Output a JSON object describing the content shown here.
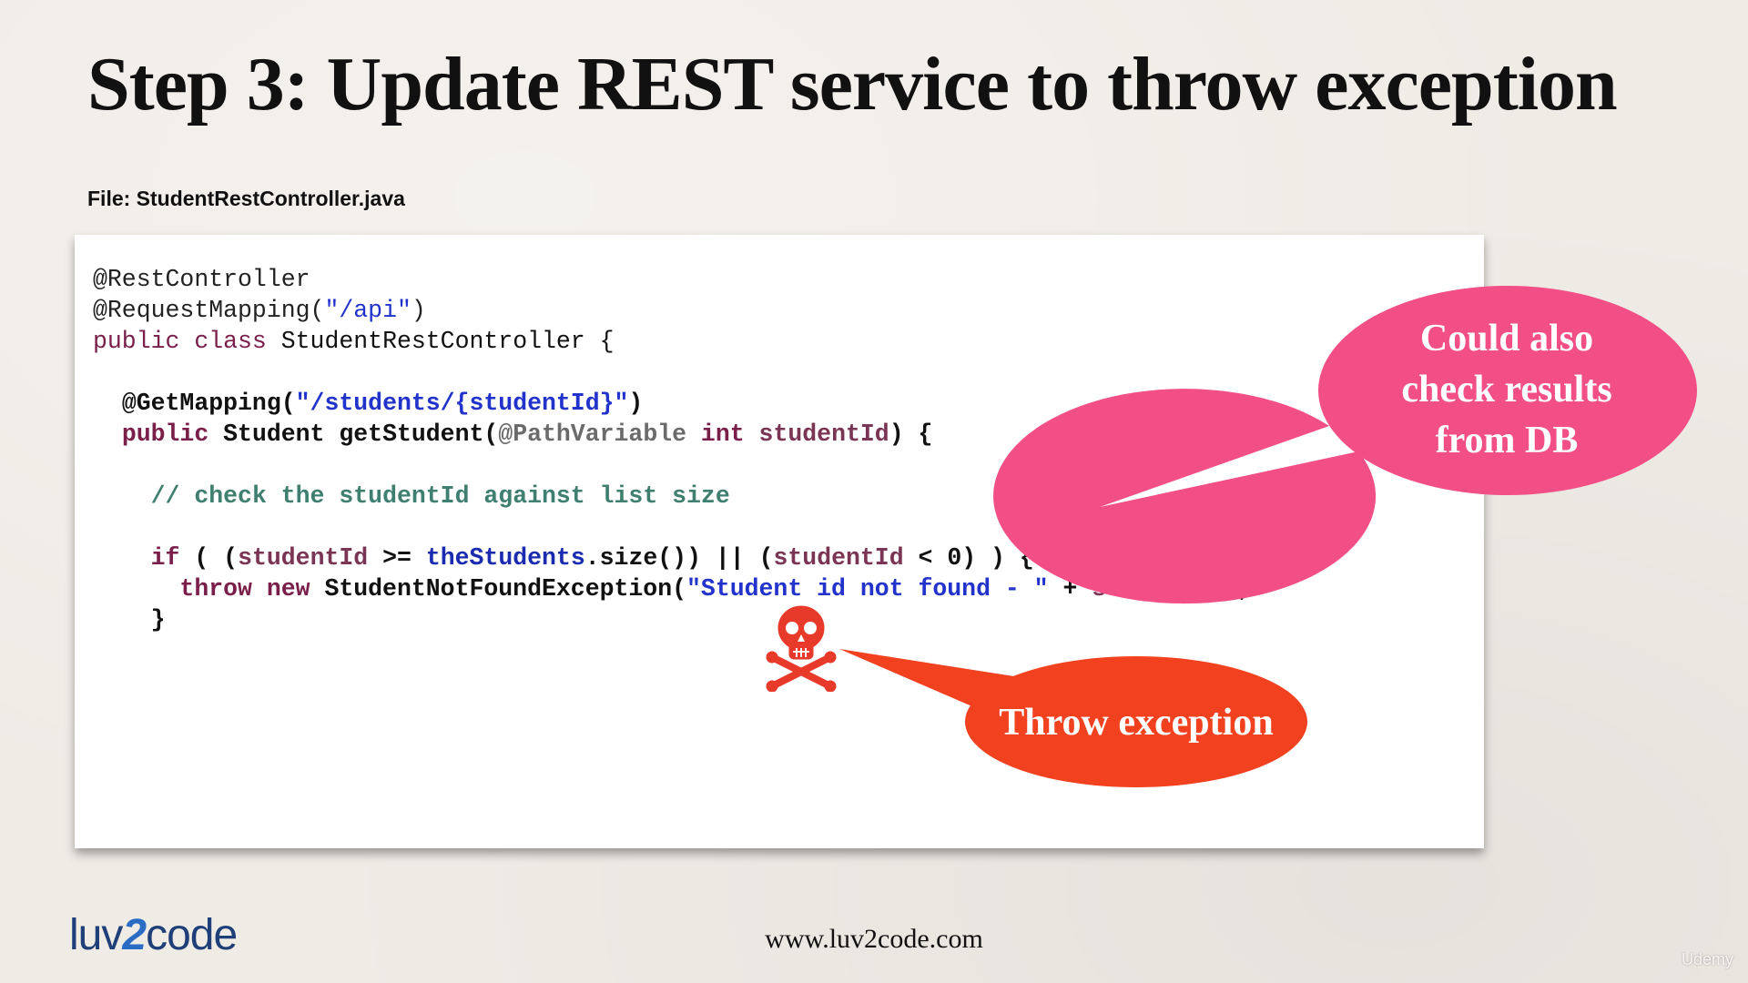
{
  "slide": {
    "title": "Step 3:  Update REST service to throw exception",
    "file_label": "File: StudentRestController.java"
  },
  "code": {
    "line1_annotation": "@RestController",
    "line2_annotation": "@RequestMapping(",
    "line2_string": "\"/api\"",
    "line2_close": ")",
    "line3_kw": "public class",
    "line3_name": " StudentRestController {",
    "line5_annotation": "@GetMapping(",
    "line5_string": "\"/students/{studentId}\"",
    "line5_close": ")",
    "line6_kw": "public",
    "line6_mid": " Student getStudent(",
    "line6_ann": "@PathVariable",
    "line6_type": " int",
    "line6_var": " studentId",
    "line6_close": ") {",
    "line8_comment": "// check the studentId against list size",
    "line10_kw": "if",
    "line10_a": " ( (",
    "line10_var1": "studentId",
    "line10_b": " >= ",
    "line10_field": "theStudents",
    "line10_c": ".size()) || (",
    "line10_var2": "studentId",
    "line10_d": " < 0) ) {",
    "line11_kw": "throw new",
    "line11_a": " StudentNotFoundException(",
    "line11_string": "\"Student id not found - \"",
    "line11_b": " + ",
    "line11_var": "studentId",
    "line11_c": ");",
    "line12_close": "}"
  },
  "callouts": {
    "db_line1": "Could also",
    "db_line2": "check results",
    "db_line3": "from DB",
    "throw_label": "Throw exception"
  },
  "colors": {
    "db_bubble": "#f24f86",
    "throw_bubble": "#f2411f",
    "skull": "#e83a2a"
  },
  "footer": {
    "logo_left": "luv",
    "logo_two": "2",
    "logo_right": "code",
    "url": "www.luv2code.com",
    "watermark": "Udemy"
  }
}
